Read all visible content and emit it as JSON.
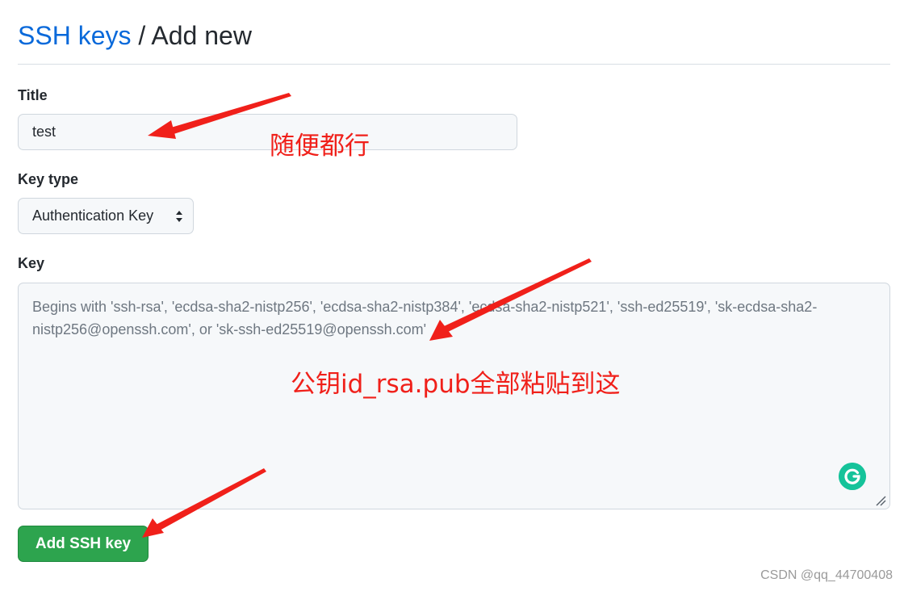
{
  "header": {
    "link_label": "SSH keys",
    "separator": " / ",
    "current": "Add new"
  },
  "form": {
    "title_label": "Title",
    "title_value": "test",
    "key_type_label": "Key type",
    "key_type_value": "Authentication Key",
    "key_label": "Key",
    "key_placeholder": "Begins with 'ssh-rsa', 'ecdsa-sha2-nistp256', 'ecdsa-sha2-nistp384', 'ecdsa-sha2-nistp521', 'ssh-ed25519', 'sk-ecdsa-sha2-nistp256@openssh.com', or 'sk-ssh-ed25519@openssh.com'",
    "submit_label": "Add SSH key"
  },
  "annotations": {
    "title_note": "随便都行",
    "key_note": "公钥id_rsa.pub全部粘贴到这",
    "arrow_color": "#f0201a"
  },
  "colors": {
    "link": "#0969da",
    "button": "#2da44e",
    "grammarly": "#15c39a"
  },
  "watermark": "CSDN @qq_44700408"
}
